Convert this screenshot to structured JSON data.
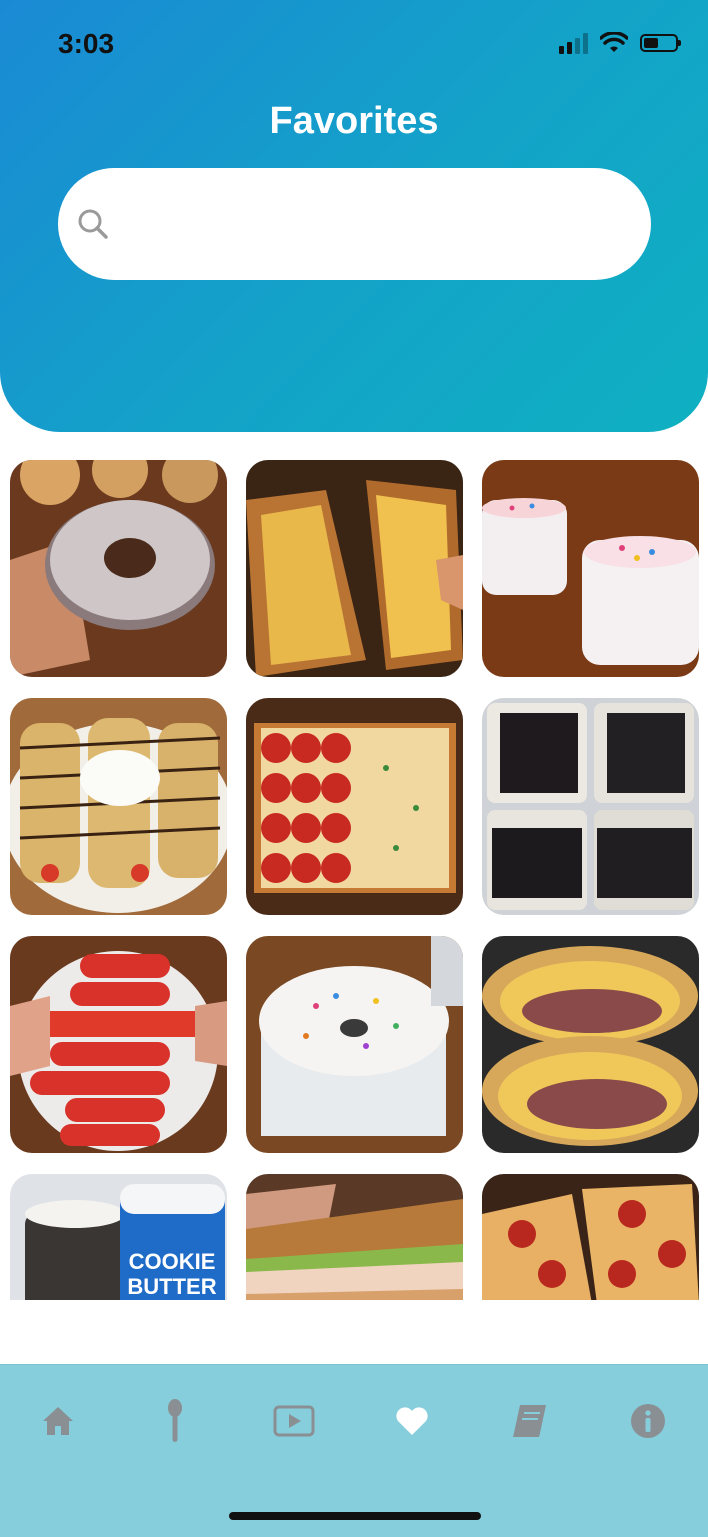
{
  "status_bar": {
    "time": "3:03"
  },
  "header": {
    "title": "Favorites"
  },
  "search": {
    "value": "",
    "placeholder": ""
  },
  "favorites": [
    {
      "name": "glazed-chocolate-donut"
    },
    {
      "name": "mac-and-cheese-grilled-cheese"
    },
    {
      "name": "funfetti-jars"
    },
    {
      "name": "chocolate-crepes-whipped-cream"
    },
    {
      "name": "sheet-pan-pizza"
    },
    {
      "name": "cookies-and-cream-bars"
    },
    {
      "name": "hot-cheeto-mozzarella-sticks"
    },
    {
      "name": "funfetti-ice-cream-bowl"
    },
    {
      "name": "mac-and-cheese-burger-wrap"
    },
    {
      "name": "cookie-butter-jar"
    },
    {
      "name": "turkey-sandwich"
    },
    {
      "name": "pepperoni-pizza-slices"
    }
  ],
  "tabbar": {
    "active": "favorites",
    "tabs": [
      "home",
      "ingredients",
      "videos",
      "favorites",
      "recipes-book",
      "info"
    ],
    "inactive_color": "#8a8f93",
    "active_color": "#ffffff"
  },
  "colors": {
    "header_start": "#1a8ad4",
    "header_end": "#0fb0c2",
    "tabbar": "#86cedb"
  }
}
